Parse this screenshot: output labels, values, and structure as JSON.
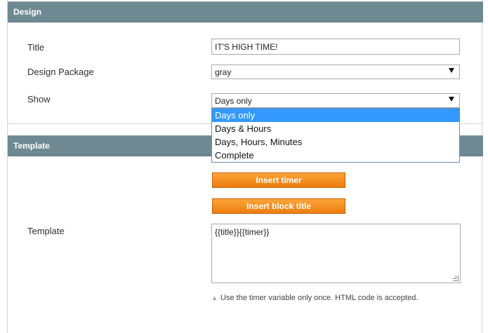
{
  "design": {
    "header": "Design",
    "title_label": "Title",
    "title_value": "IT'S HIGH TIME!",
    "package_label": "Design Package",
    "package_value": "gray",
    "show_label": "Show",
    "show_value": "Days only",
    "show_options": [
      "Days only",
      "Days & Hours",
      "Days, Hours, Minutes",
      "Complete"
    ]
  },
  "template": {
    "header": "Template",
    "insert_timer_label": "Insert timer",
    "insert_title_label": "Insert block title",
    "template_label": "Template",
    "template_value": "{{title}}{{timer}}",
    "note_text": "Use the timer variable only once. HTML code is accepted."
  },
  "icons": {
    "note": "triangle-up-icon",
    "select_arrow": "caret-down-icon",
    "resize": "resize-grip-icon"
  },
  "colors": {
    "header_bg": "#6f8992",
    "button_bg": "#f39023",
    "selected_option": "#3399ff"
  }
}
